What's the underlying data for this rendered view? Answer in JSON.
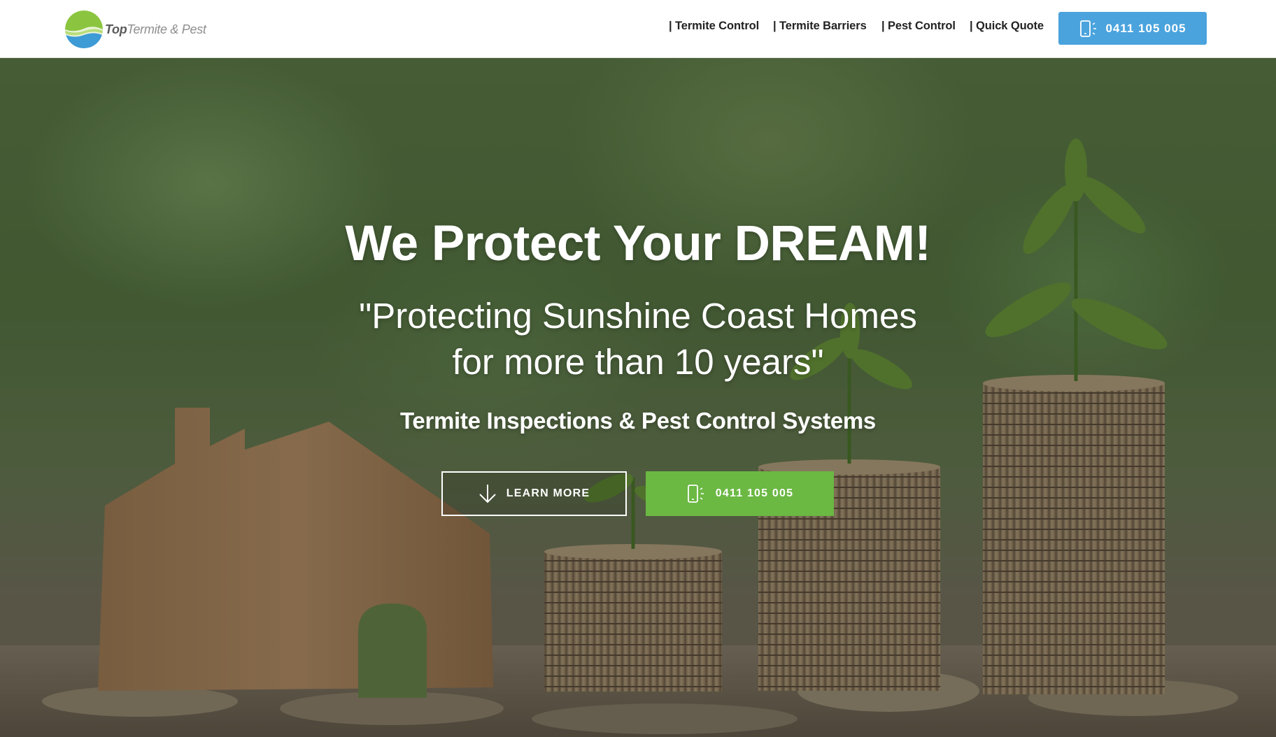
{
  "brand": {
    "logo_top": "Top",
    "logo_rest": "Termite & Pest"
  },
  "nav": {
    "items": [
      {
        "label": "| Termite Control"
      },
      {
        "label": "| Termite Barriers"
      },
      {
        "label": "| Pest Control"
      },
      {
        "label": "| Quick Quote"
      }
    ],
    "phone_button": "0411 105 005"
  },
  "hero": {
    "headline": "We Protect Your DREAM!",
    "subline_1": "\"Protecting Sunshine Coast Homes",
    "subline_2": "for more than 10 years\"",
    "tagline": "Termite Inspections & Pest Control Systems",
    "learn_more": "LEARN MORE",
    "phone": "0411 105 005"
  },
  "icons": {
    "phone": "phone-ringing-icon",
    "arrow": "arrow-down-icon"
  },
  "colors": {
    "header_button": "#4aa3dd",
    "call_button": "#6bb843",
    "text_dark": "#222222",
    "logo_green": "#8bc53f",
    "logo_blue": "#3d9bd6"
  }
}
